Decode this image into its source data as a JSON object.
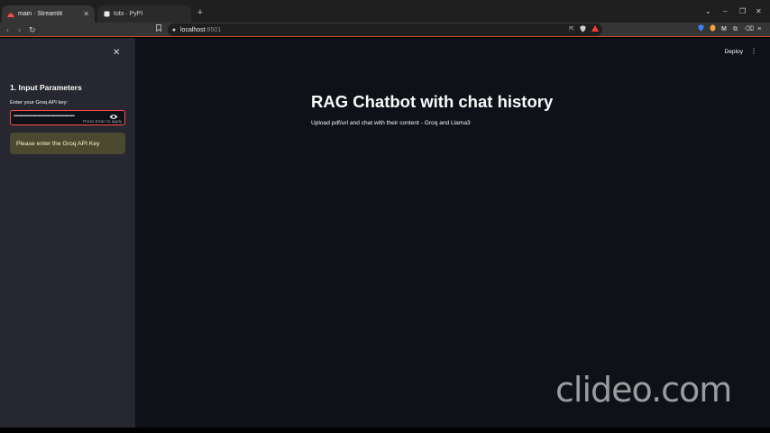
{
  "browser": {
    "tabs": [
      {
        "title": "main · Streamlit",
        "active": true
      },
      {
        "title": "tobi · PyPI",
        "active": false
      }
    ],
    "new_tab": "+",
    "address": {
      "host": "localhost",
      "port": ":8501"
    },
    "window_controls": {
      "dropdown": "⌄",
      "minimize": "–",
      "restore": "❐",
      "close": "✕"
    }
  },
  "sidebar": {
    "close": "✕",
    "section_title": "1. Input Parameters",
    "api_key_label": "Enter your Groq API key:",
    "api_key_value": "••••••••••••••••••••••••••••••••••••••••••••••••••••••",
    "input_hint": "Press Enter to apply",
    "warning": "Please enter the Groq API Key"
  },
  "main": {
    "deploy_label": "Deploy",
    "title": "RAG Chatbot with chat history",
    "subtitle": "Upload pdf/url and chat with their content - Groq and Llama3"
  },
  "watermark": "clideo.com",
  "colors": {
    "sidebar_bg": "#262730",
    "main_bg": "#0e1117",
    "input_focus_border": "#ff4b4b",
    "warning_bg": "#4c4931",
    "warning_text": "#fff6c8"
  }
}
